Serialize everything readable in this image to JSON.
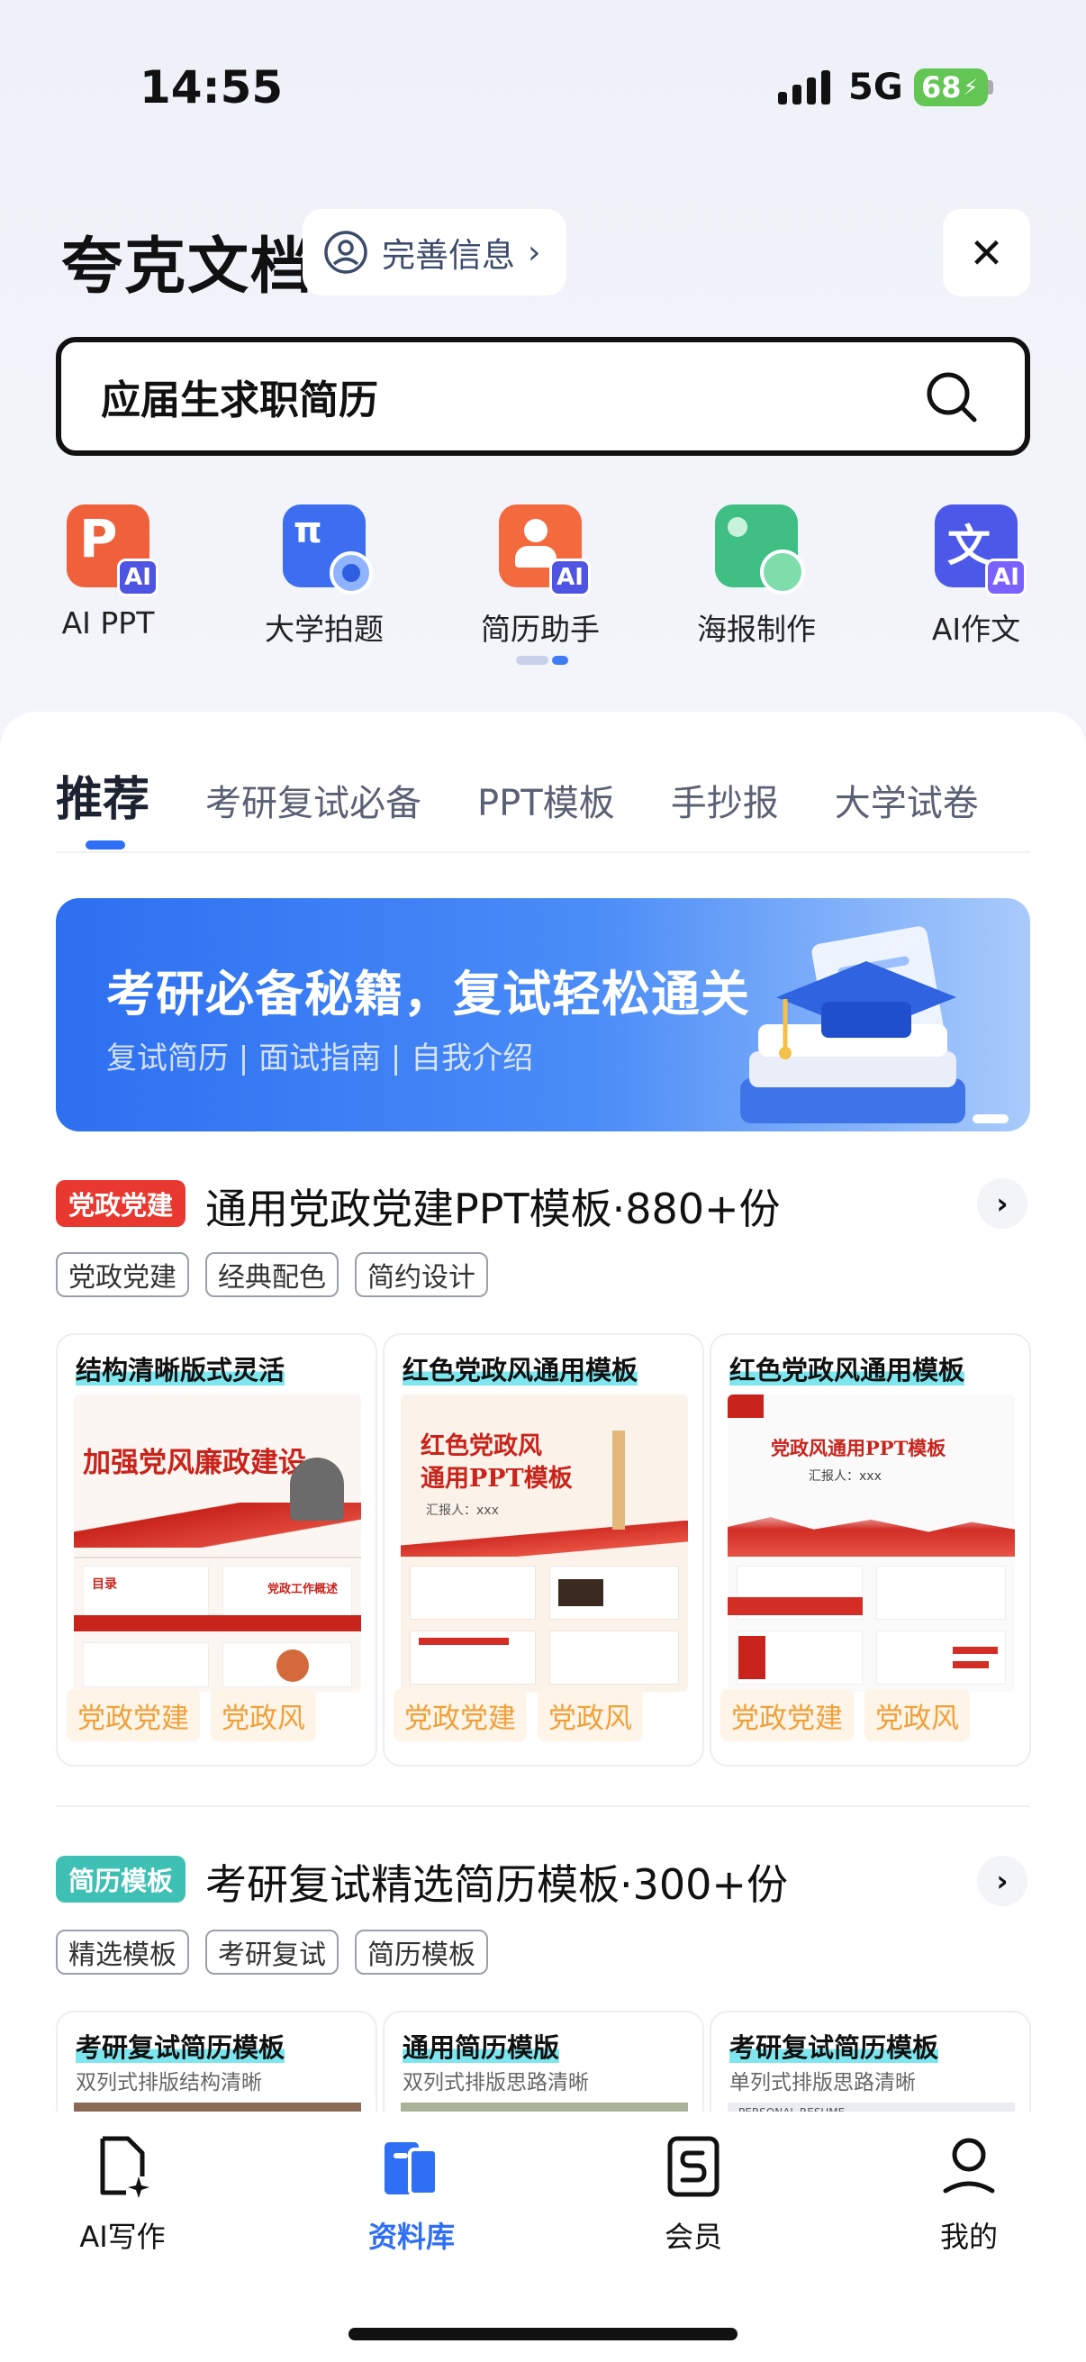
{
  "status_bar": {
    "time": "14:55",
    "network": "5G",
    "battery": "68"
  },
  "header": {
    "app_title": "夸克文档",
    "profile_label": "完善信息",
    "close_label": "✕"
  },
  "search": {
    "value": "应届生求职简历",
    "icon": "search-icon"
  },
  "tools": [
    {
      "label": "AI PPT",
      "icon": "ppt-icon",
      "color": "#f0603a"
    },
    {
      "label": "大学拍题",
      "icon": "camera-pi-icon",
      "color": "#3d6ef0"
    },
    {
      "label": "简历助手",
      "icon": "resume-icon",
      "color": "#f26a3e"
    },
    {
      "label": "海报制作",
      "icon": "poster-icon",
      "color": "#3fbf84"
    },
    {
      "label": "AI作文",
      "icon": "essay-icon",
      "color": "#4c58e8"
    }
  ],
  "tabs": [
    "推荐",
    "考研复试必备",
    "PPT模板",
    "手抄报",
    "大学试卷"
  ],
  "banner": {
    "title": "考研必备秘籍，复试轻松通关",
    "subtitle": "复试简历 | 面试指南 | 自我介绍"
  },
  "section_party": {
    "tag": "党政党建",
    "tag_color": "#e8382f",
    "title": "通用党政党建PPT模板·880+份",
    "chips": [
      "党政党建",
      "经典配色",
      "简约设计"
    ],
    "cards": [
      {
        "title": "结构清晰版式灵活",
        "tags": [
          "党政党建",
          "党政风"
        ],
        "cover_text": "加强党风廉政建设",
        "inner_text": "党政工作概述",
        "toc": "目录"
      },
      {
        "title": "红色党政风通用模板",
        "tags": [
          "党政党建",
          "党政风"
        ],
        "cover_text": "红色党政风\n通用PPT模板",
        "presenter": "汇报人：xxx"
      },
      {
        "title": "红色党政风通用模板",
        "tags": [
          "党政党建",
          "党政风"
        ],
        "cover_text": "党政风通用PPT模板",
        "presenter": "汇报人：xxx"
      }
    ]
  },
  "section_resume": {
    "tag": "简历模板",
    "tag_color": "#3ec0b4",
    "title": "考研复试精选简历模板·300+份",
    "chips": [
      "精选模板",
      "考研复试",
      "简历模板"
    ],
    "cards": [
      {
        "title": "考研复试简历模板",
        "subtitle": "双列式排版结构清晰"
      },
      {
        "title": "通用简历模版",
        "subtitle": "双列式排版思路清晰"
      },
      {
        "title": "考研复试简历模板",
        "subtitle": "单列式排版思路清晰",
        "preview_text": "PERSONAL RESUME"
      }
    ]
  },
  "bottom_nav": [
    {
      "label": "AI写作",
      "icon": "ai-write-icon",
      "active": false
    },
    {
      "label": "资料库",
      "icon": "library-icon",
      "active": true
    },
    {
      "label": "会员",
      "icon": "vip-icon",
      "active": false
    },
    {
      "label": "我的",
      "icon": "profile-icon",
      "active": false
    }
  ]
}
